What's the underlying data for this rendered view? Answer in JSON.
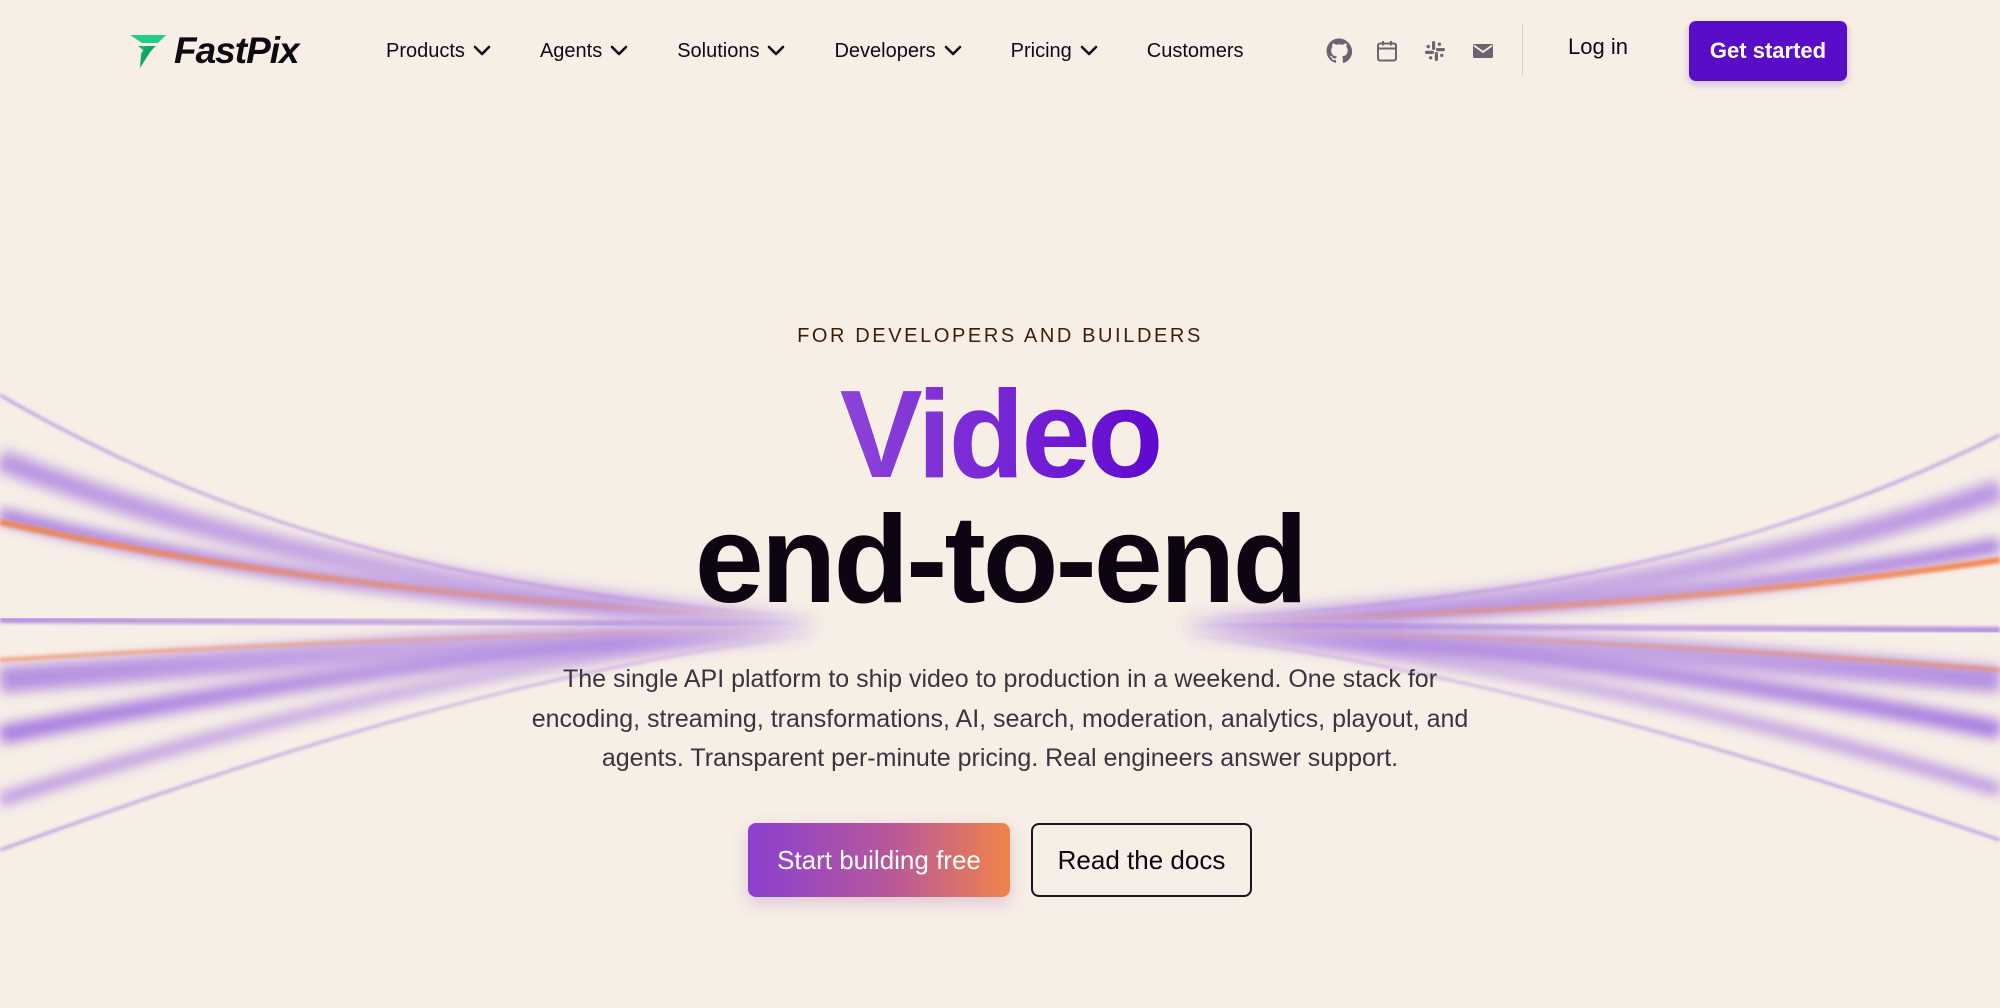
{
  "brand": {
    "name": "FastPix",
    "logo_color": "#1fd08a"
  },
  "nav": {
    "items": [
      {
        "label": "Products",
        "has_dropdown": true
      },
      {
        "label": "Agents",
        "has_dropdown": true
      },
      {
        "label": "Solutions",
        "has_dropdown": true
      },
      {
        "label": "Developers",
        "has_dropdown": true
      },
      {
        "label": "Pricing",
        "has_dropdown": true
      },
      {
        "label": "Customers",
        "has_dropdown": false
      }
    ],
    "icons": [
      "github-icon",
      "calendar-icon",
      "slack-icon",
      "mail-icon"
    ],
    "login_label": "Log in",
    "get_started_label": "Get started"
  },
  "hero": {
    "eyebrow": "FOR DEVELOPERS AND BUILDERS",
    "title_line1": "Video",
    "title_line2": "end-to-end",
    "lede": "The single API platform to ship video to production in a weekend. One stack for encoding, streaming, transformations, AI, search, moderation, analytics, playout, and agents. Transparent per-minute pricing. Real engineers answer support.",
    "primary_cta": "Start building free",
    "secondary_cta": "Read the docs"
  },
  "colors": {
    "background": "#f7eee6",
    "accent": "#5a0dc9",
    "streak_purple": "#9b6ae0",
    "streak_orange": "#f2834a"
  }
}
